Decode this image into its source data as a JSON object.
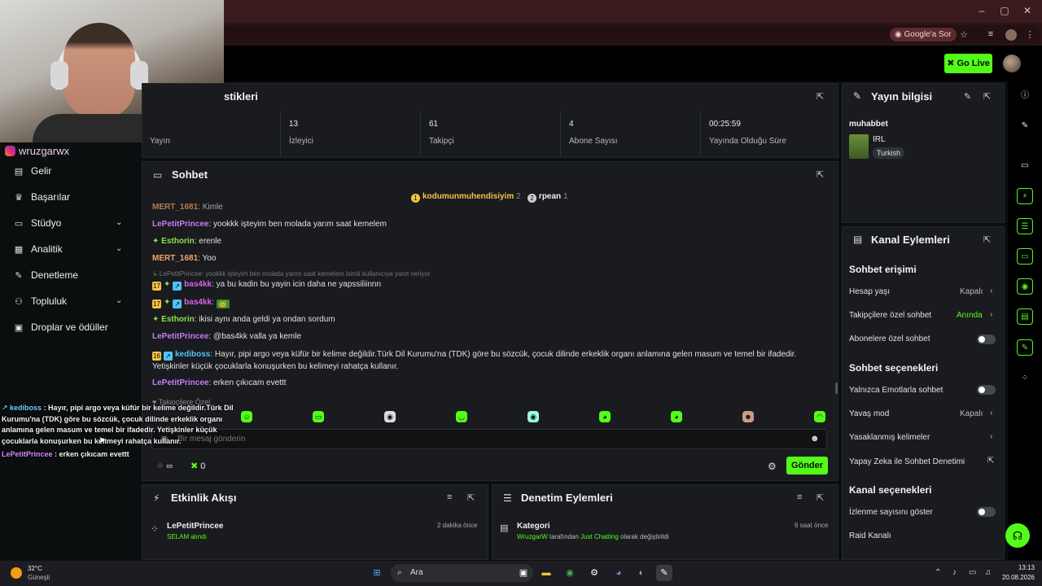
{
  "browser": {
    "google_sor": "Google'a Sor",
    "window_controls": [
      "–",
      "▢",
      "✕"
    ]
  },
  "app": {
    "go_live": "Go Live",
    "streamer_handle": "wruzgarwx"
  },
  "sidebar": {
    "items": [
      {
        "label": "Gelir",
        "icon": "wallet-icon",
        "chevron": false
      },
      {
        "label": "Başarılar",
        "icon": "trophy-icon",
        "chevron": false
      },
      {
        "label": "Stüdyo",
        "icon": "studio-icon",
        "chevron": true
      },
      {
        "label": "Analitik",
        "icon": "analytics-icon",
        "chevron": true
      },
      {
        "label": "Denetleme",
        "icon": "wrench-icon",
        "chevron": false
      },
      {
        "label": "Topluluk",
        "icon": "community-icon",
        "chevron": true
      },
      {
        "label": "Droplar ve ödüller",
        "icon": "gift-icon",
        "chevron": false
      }
    ]
  },
  "stats": {
    "title": "stikleri",
    "cells": [
      {
        "value": "",
        "label": "Yayın"
      },
      {
        "value": "13",
        "label": "İzleyici"
      },
      {
        "value": "61",
        "label": "Takipçi"
      },
      {
        "value": "4",
        "label": "Abone Sayısı"
      },
      {
        "value": "00:25:59",
        "label": "Yayında Olduğu Süre"
      }
    ]
  },
  "chat": {
    "title": "Sohbet",
    "pinned": [
      {
        "user": "kodumunmuhendisiyim",
        "count": "2"
      },
      {
        "user": "rpean",
        "count": "1"
      }
    ],
    "messages": [
      {
        "user": "MERT_1681",
        "color": "#f3a46b",
        "text": ": Kimle"
      },
      {
        "user": "LePetitPrincee",
        "color": "#c77bf5",
        "text": ": yookkk işteyim ben molada yarım saat kemelem"
      },
      {
        "user": "Esthorin",
        "color": "#8ee04a",
        "text": ": erenle"
      },
      {
        "user": "MERT_1681",
        "color": "#f3a46b",
        "text": ": Yoo"
      },
      {
        "reply": "↳ LePetitPrincee: yookkk işteyim ben molada yarım saat kemelem isimli kullanıcıya yanıt veriyor"
      },
      {
        "user": "bas4kk",
        "color": "#d565e8",
        "text": ": ya bu kadin bu yayin icin daha ne yapssiliinnn"
      },
      {
        "user": "bas4kk",
        "color": "#d565e8",
        "text": ":"
      },
      {
        "user": "Esthorin",
        "color": "#8ee04a",
        "text": ": ikisi aynı anda geldi ya ondan sordum"
      },
      {
        "user": "LePetitPrincee",
        "color": "#c77bf5",
        "text": ": @bas4kk valla ya kemle"
      },
      {
        "user": "kediboss",
        "color": "#4fc3f7",
        "text": ": Hayır, pipi argo veya küfür bir kelime değildir.Türk Dil Kurumu'na (TDK) göre bu sözcük, çocuk dilinde erkeklik organı anlamına gelen masum ve temel bir ifadedir."
      },
      {
        "cont": "Yetişkinler küçük çocuklarla konuşurken bu kelimeyi rahatça kullanır."
      },
      {
        "user": "LePetitPrincee",
        "color": "#c77bf5",
        "text": ": erken çıkıcam evettt"
      }
    ],
    "followers_only": "Takipçilere Özel",
    "placeholder": "Bir mesaj gönderin",
    "points": "∞",
    "count": "0",
    "send": "Gönder"
  },
  "stream_info": {
    "title": "Yayın bilgisi",
    "stream_title": "muhabbet",
    "category": "IRL",
    "language": "Turkish"
  },
  "channel_actions": {
    "title": "Kanal Eylemleri",
    "chat_access": "Sohbet erişimi",
    "account_age": "Hesap yaşı",
    "account_age_val": "Kapalı",
    "followers_chat": "Takipçilere özel sohbet",
    "followers_chat_val": "Anında",
    "subs_chat": "Abonelere özel sohbet",
    "chat_options": "Sohbet seçenekleri",
    "emote_only": "Yalnızca Emotlarla sohbet",
    "slow_mode": "Yavaş mod",
    "slow_mode_val": "Kapalı",
    "banned_words": "Yasaklanmış kelimeler",
    "ai_mod": "Yapay Zeka ile Sohbet Denetimi",
    "channel_options": "Kanal seçenekleri",
    "show_views": "İzlenme sayısını göster",
    "raid": "Raid Kanalı"
  },
  "activity": {
    "title": "Etkinlik Akışı",
    "items": [
      {
        "user": "LePetitPrincee",
        "detail": "SELAM alındı",
        "time": "2 dakika önce"
      }
    ]
  },
  "moderation": {
    "title": "Denetim Eylemleri",
    "items": [
      {
        "title": "Kategori",
        "actor": "WruzgarW",
        "middle": " tarafından ",
        "target": "Just Chatting",
        "end": " olarak değiştirildi",
        "time": "6 saat önce"
      }
    ]
  },
  "overlay": {
    "user1": "kediboss",
    "msg1": " : Hayır, pipi argo veya küfür bir kelime değildir.Türk Dil Kurumu'na (TDK) göre bu sözcük, çocuk dilinde erkeklik organı anlamına gelen masum ve temel bir ifadedir. Yetişkinler küçük çocuklarla konuşurken bu kelimeyi rahatça kullanır.",
    "user2": "LePetitPrincee",
    "msg2": " : erken çıkıcam evettt"
  },
  "taskbar": {
    "weather_temp": "32°C",
    "weather_text": "Güneşli",
    "search": "Ara",
    "time": "13:13",
    "date": "20.08.2026"
  },
  "colors": {
    "accent": "#53fc18",
    "panel": "#191b1f",
    "background": "#0b0e0f"
  }
}
